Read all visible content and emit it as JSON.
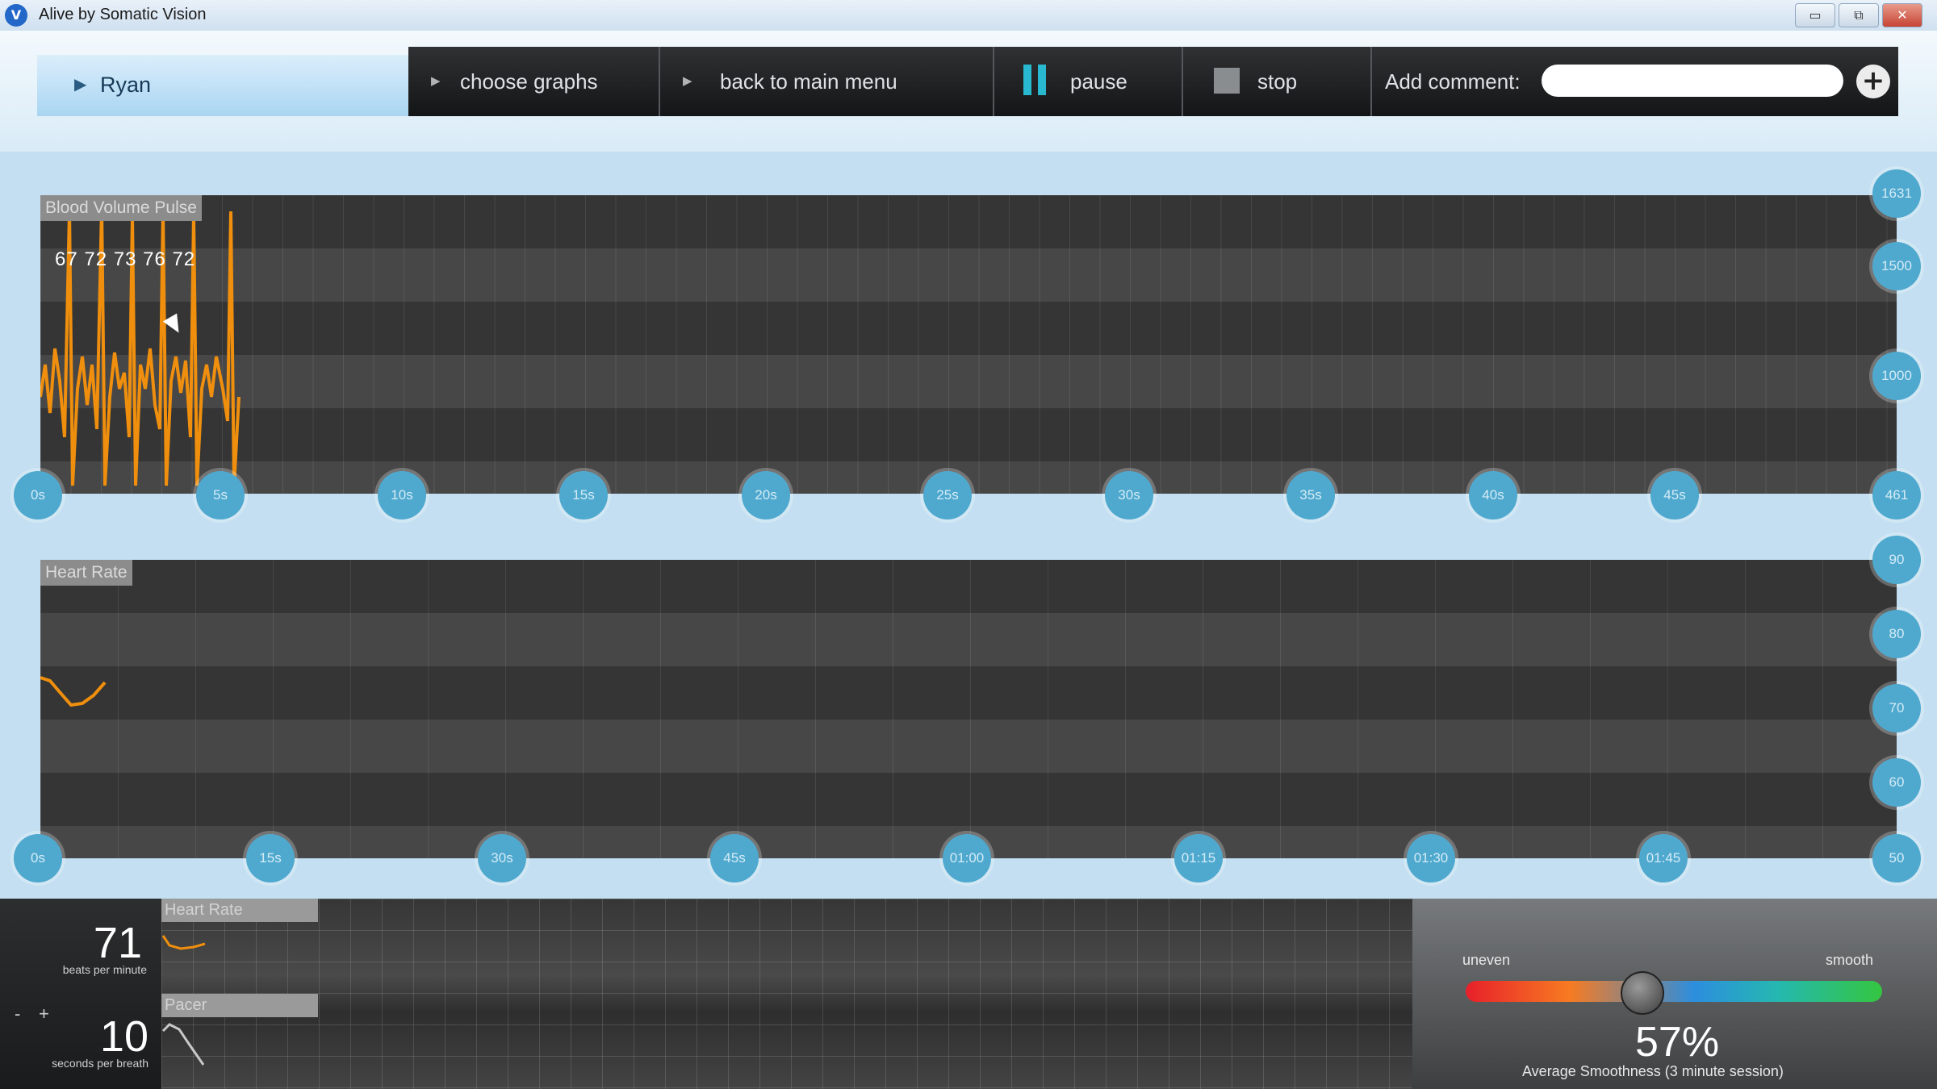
{
  "window": {
    "title": "Alive by Somatic Vision",
    "logo_icon": "somatic-vision-logo",
    "controls": [
      "▭",
      "⧉",
      "✕"
    ]
  },
  "user": {
    "name": "Ryan"
  },
  "toolbar": {
    "choose_graphs": "choose graphs",
    "back_to_main_menu": "back to main menu",
    "pause": "pause",
    "stop": "stop",
    "add_comment_label": "Add comment:",
    "comment_value": "",
    "add_icon": "+"
  },
  "bvp_graph": {
    "title": "Blood Volume Pulse",
    "readings_text": "67 72 73 76 72",
    "x_ticks": [
      "0s",
      "5s",
      "10s",
      "15s",
      "20s",
      "25s",
      "30s",
      "35s",
      "40s",
      "45s",
      "461"
    ],
    "y_ticks": [
      "1631",
      "1500",
      "1000"
    ]
  },
  "hr_graph": {
    "title": "Heart Rate",
    "x_ticks": [
      "0s",
      "15s",
      "30s",
      "45s",
      "01:00",
      "01:15",
      "01:30",
      "01:45",
      "50"
    ],
    "y_ticks": [
      "90",
      "80",
      "70",
      "60"
    ]
  },
  "bottom": {
    "bpm_value": "71",
    "bpm_unit": "beats per minute",
    "pacer_minus": "-",
    "pacer_plus": "+",
    "pacer_value": "10",
    "pacer_unit": "seconds per breath",
    "mini_hr_title": "Heart Rate",
    "mini_pacer_title": "Pacer"
  },
  "smoothness": {
    "left_label": "uneven",
    "right_label": "smooth",
    "value": 0.42,
    "percent_text": "57%",
    "caption": "Average Smoothness (3 minute session)"
  },
  "colors": {
    "signal": "#ef8f0d",
    "accent": "#28b8cf",
    "bubble": "#4fa9cf"
  }
}
